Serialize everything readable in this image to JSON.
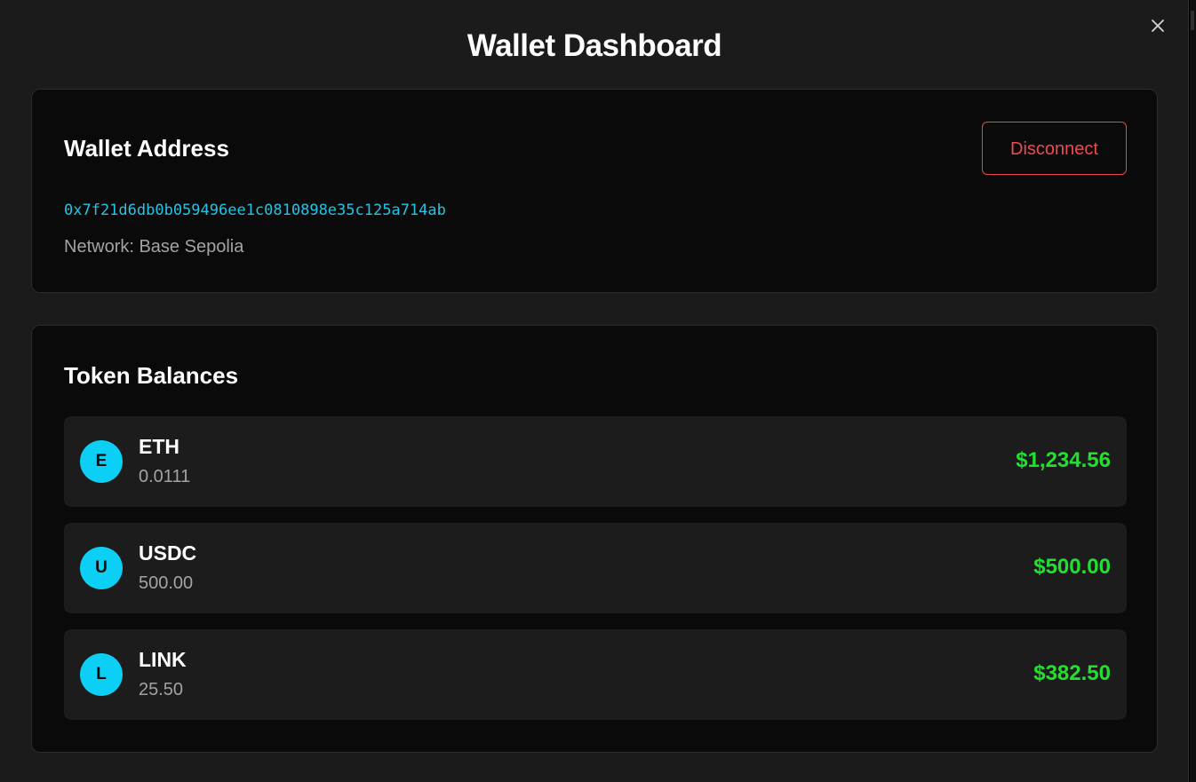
{
  "modal": {
    "title": "Wallet Dashboard",
    "close_icon": "close-icon"
  },
  "wallet": {
    "heading": "Wallet Address",
    "address": "0x7f21d6db0b059496ee1c0810898e35c125a714ab",
    "network": "Network: Base Sepolia",
    "disconnect_label": "Disconnect"
  },
  "tokens": {
    "heading": "Token Balances",
    "items": [
      {
        "initial": "E",
        "symbol": "ETH",
        "amount": "0.0111",
        "value": "$1,234.56"
      },
      {
        "initial": "U",
        "symbol": "USDC",
        "amount": "500.00",
        "value": "$500.00"
      },
      {
        "initial": "L",
        "symbol": "LINK",
        "amount": "25.50",
        "value": "$382.50"
      }
    ]
  },
  "colors": {
    "background": "#1b1b1b",
    "card": "#0a0a0a",
    "token_row": "#1c1c1c",
    "address": "#22c4e6",
    "danger": "#ef4a4f",
    "positive": "#22e02e",
    "avatar": "#0ccff5",
    "muted_text": "#a3a3a3"
  }
}
